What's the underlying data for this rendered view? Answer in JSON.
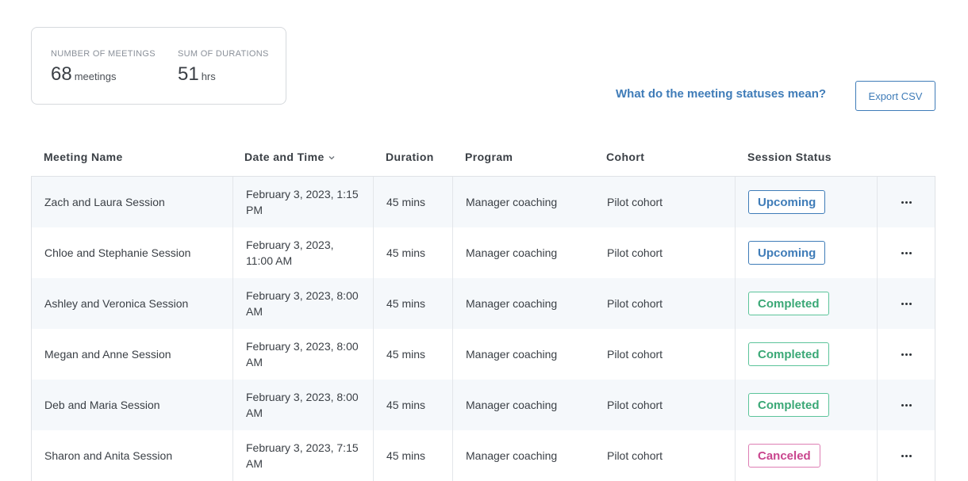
{
  "summary": {
    "meetings": {
      "label": "NUMBER OF MEETINGS",
      "value": "68",
      "unit": "meetings"
    },
    "durations": {
      "label": "SUM OF DURATIONS",
      "value": "51",
      "unit": "hrs"
    }
  },
  "help_link": "What do the meeting statuses mean?",
  "export_label": "Export CSV",
  "table": {
    "headers": {
      "name": "Meeting Name",
      "date": "Date and Time",
      "duration": "Duration",
      "program": "Program",
      "cohort": "Cohort",
      "status": "Session Status"
    },
    "rows": [
      {
        "name": "Zach and Laura Session",
        "date": "February 3, 2023, 1:15 PM",
        "duration": "45 mins",
        "program": "Manager coaching",
        "cohort": "Pilot cohort",
        "status": "Upcoming",
        "status_type": "upcoming"
      },
      {
        "name": "Chloe and Stephanie Session",
        "date": "February 3, 2023, 11:00 AM",
        "duration": "45 mins",
        "program": "Manager coaching",
        "cohort": "Pilot cohort",
        "status": "Upcoming",
        "status_type": "upcoming"
      },
      {
        "name": "Ashley and Veronica Session",
        "date": "February 3, 2023, 8:00 AM",
        "duration": "45 mins",
        "program": "Manager coaching",
        "cohort": "Pilot cohort",
        "status": "Completed",
        "status_type": "completed"
      },
      {
        "name": "Megan and Anne Session",
        "date": "February 3, 2023, 8:00 AM",
        "duration": "45 mins",
        "program": "Manager coaching",
        "cohort": "Pilot cohort",
        "status": "Completed",
        "status_type": "completed"
      },
      {
        "name": "Deb and Maria Session",
        "date": "February 3, 2023, 8:00 AM",
        "duration": "45 mins",
        "program": "Manager coaching",
        "cohort": "Pilot cohort",
        "status": "Completed",
        "status_type": "completed"
      },
      {
        "name": "Sharon and Anita Session",
        "date": "February 3, 2023, 7:15 AM",
        "duration": "45 mins",
        "program": "Manager coaching",
        "cohort": "Pilot cohort",
        "status": "Canceled",
        "status_type": "canceled"
      }
    ]
  },
  "colors": {
    "accent": "#3f7cb8",
    "completed": "#3aa876",
    "canceled": "#c9468e",
    "row_alt": "#f5f8fb"
  },
  "icons": {
    "sort": "chevron-down-icon",
    "row_menu": "more-horizontal-icon"
  }
}
